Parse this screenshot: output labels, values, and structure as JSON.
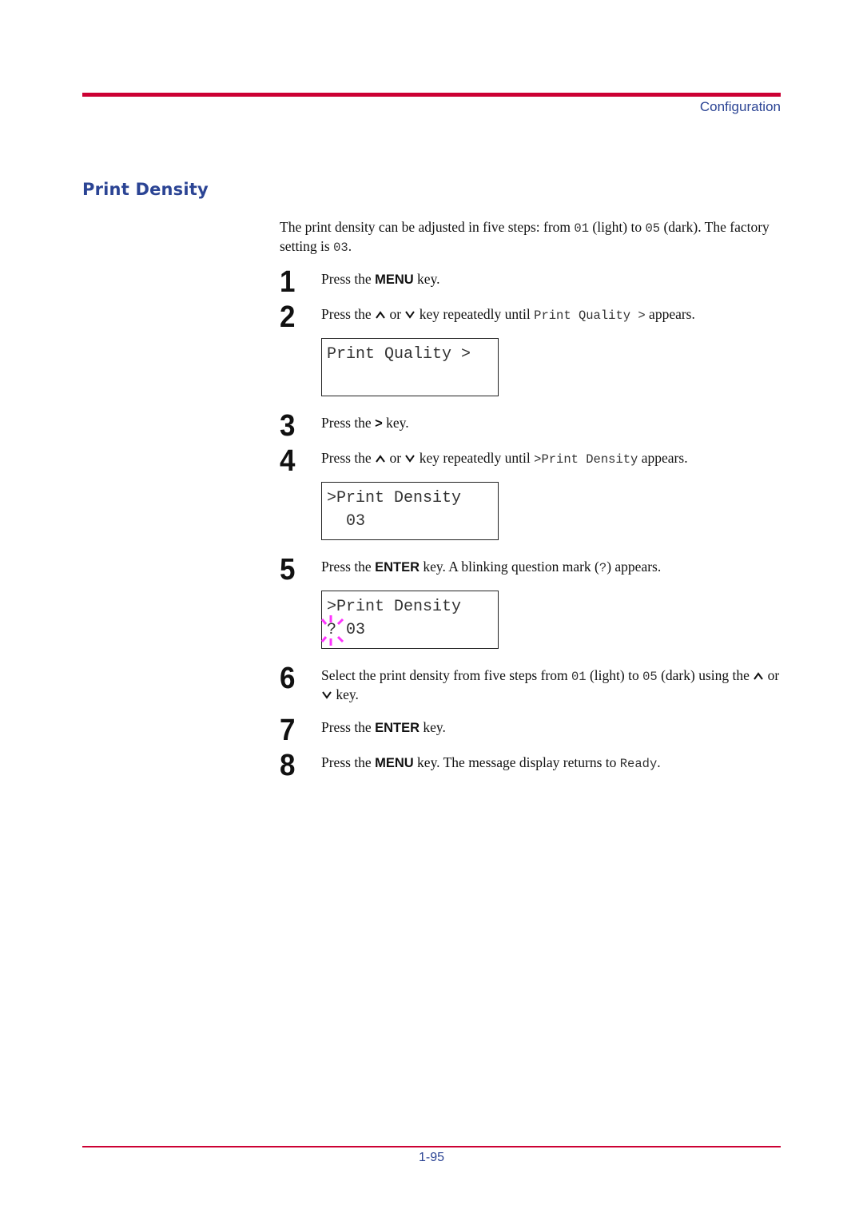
{
  "header": {
    "section": "Configuration",
    "rule_color": "#cc0033",
    "accent_color": "#2b4494"
  },
  "title": "Print Density",
  "intro": {
    "p1": "The print density can be adjusted in five steps: from ",
    "v1": "01",
    "p2": " (light) to ",
    "v2": "05",
    "p3": " (dark). The factory setting is ",
    "v3": "03",
    "p4": "."
  },
  "steps": [
    {
      "num": "1",
      "a": "Press the ",
      "key": "MENU",
      "b": " key."
    },
    {
      "num": "2",
      "a": "Press the ",
      "or": " or ",
      "b": " key repeatedly until ",
      "code": "Print Quality >",
      "c": " appears."
    },
    {
      "num": "3",
      "a": "Press the ",
      "key": ">",
      "b": " key."
    },
    {
      "num": "4",
      "a": "Press the ",
      "or": " or ",
      "b": " key repeatedly until ",
      "code": ">Print Density",
      "c": " appears."
    },
    {
      "num": "5",
      "a": "Press the ",
      "key": "ENTER",
      "b": " key. A blinking question mark (",
      "code": "?",
      "c": ") appears."
    },
    {
      "num": "6",
      "a": "Select the print density from five steps from ",
      "v1": "01",
      "b": " (light) to ",
      "v2": "05",
      "c": " (dark) using the ",
      "or": " or ",
      "d": " key."
    },
    {
      "num": "7",
      "a": "Press the ",
      "key": "ENTER",
      "b": " key."
    },
    {
      "num": "8",
      "a": "Press the ",
      "key": "MENU",
      "b": " key. The message display returns to ",
      "code": "Ready",
      "c": "."
    }
  ],
  "displays": [
    {
      "line1": "Print Quality >",
      "line2": ""
    },
    {
      "line1": ">Print Density",
      "line2": "  03"
    },
    {
      "line1": ">Print Density",
      "line2": "? 03",
      "blink_color": "#ff33ff"
    }
  ],
  "footer": {
    "page": "1-95"
  }
}
